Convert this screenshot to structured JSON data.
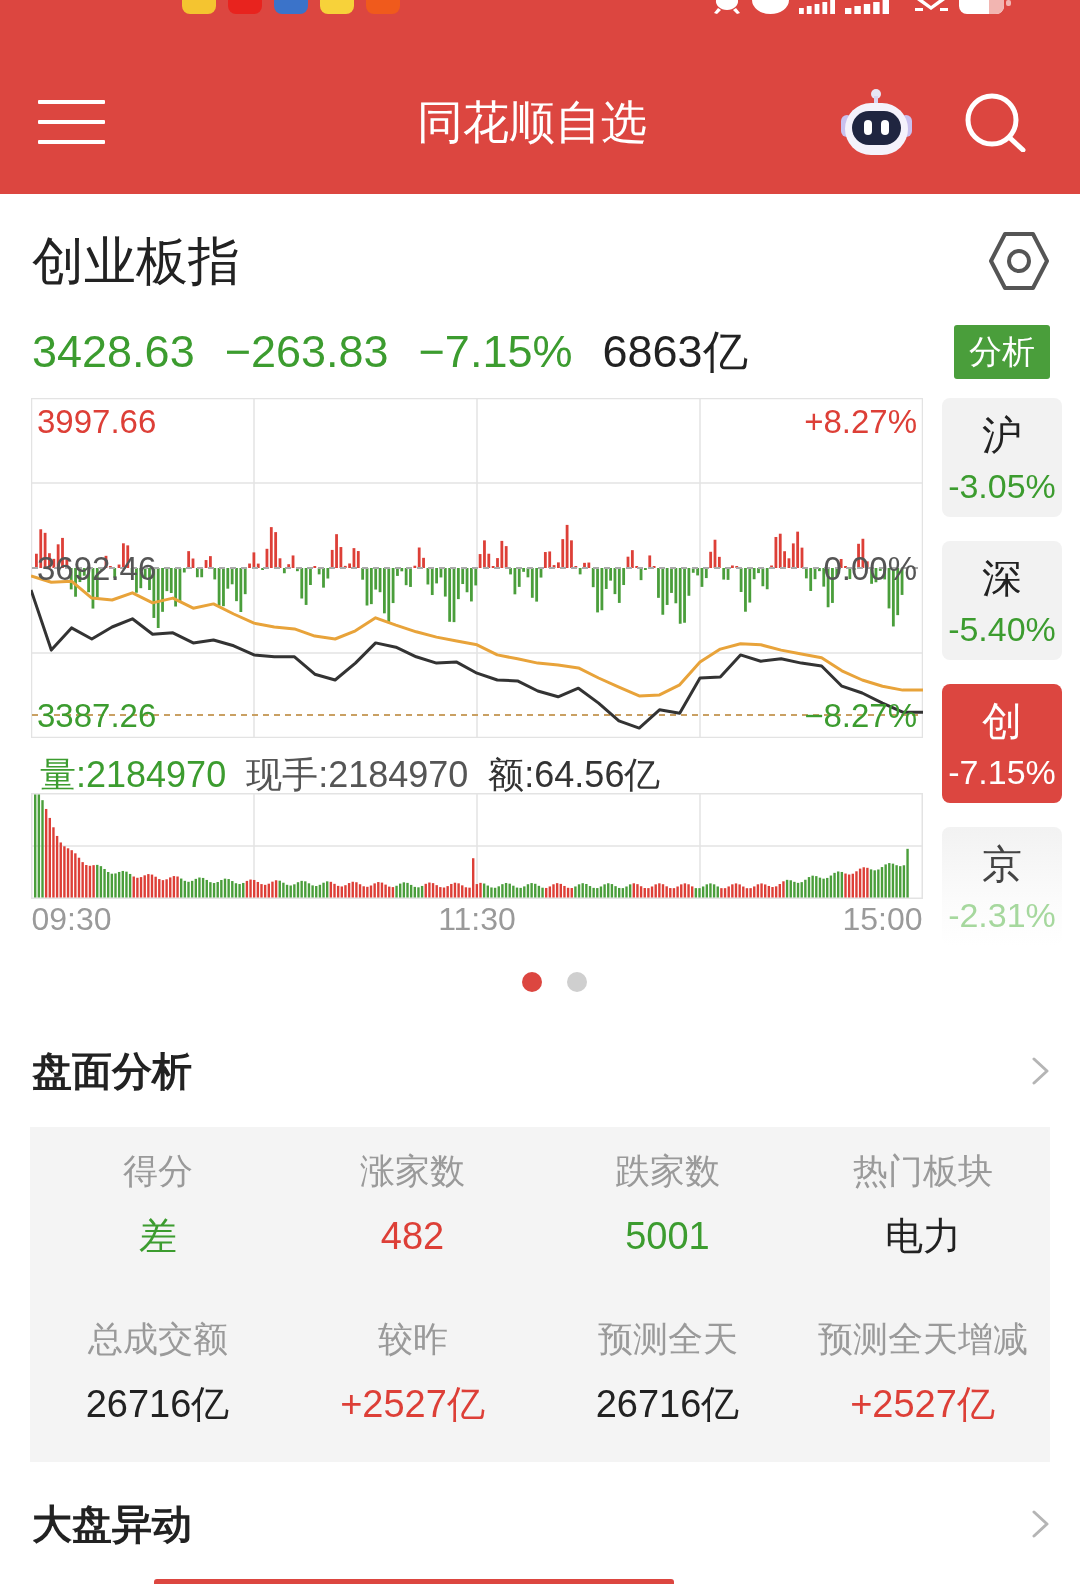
{
  "header": {
    "title": "同花顺自选"
  },
  "index": {
    "name": "创业板指",
    "price": "3428.63",
    "change": "−263.83",
    "change_pct": "−7.15%",
    "turnover": "6863亿",
    "color": "#3c9c2f",
    "analysis_button": "分析"
  },
  "chart": {
    "percent_labels": [
      "+8.27%",
      "0.00%",
      "−8.27%"
    ],
    "volume_stats": [
      {
        "text": "量:2184970",
        "color": "#3c9c2f"
      },
      {
        "text": "现手:2184970",
        "color": "#555555"
      },
      {
        "text": "额:64.56亿",
        "color": "#333333"
      }
    ],
    "chart_data": {
      "type": "line",
      "categories": [
        null,
        null,
        "09:30",
        null,
        null,
        null,
        null,
        null,
        null,
        null,
        null,
        null,
        null,
        null,
        null,
        null,
        null,
        null,
        null,
        null,
        null,
        null,
        "11:30",
        null,
        null,
        null,
        null,
        null,
        null,
        null,
        null,
        null,
        null,
        null,
        null,
        null,
        null,
        null,
        null,
        null,
        null,
        null,
        "15:00",
        null,
        null
      ],
      "series": [
        {
          "color": "#333333",
          "values": [
            3647,
            3522,
            3568,
            3545,
            3570,
            3587,
            3555,
            3558,
            3537,
            3543,
            3531,
            3512,
            3508,
            3508,
            3472,
            3460,
            3495,
            3537,
            3528,
            3508,
            3495,
            3497,
            3474,
            3460,
            3458,
            3437,
            3425,
            3443,
            3412,
            3375,
            3360,
            3398,
            3391,
            3464,
            3466,
            3512,
            3499,
            3504,
            3495,
            3489,
            3447,
            3433,
            3412,
            3393,
            3393
          ]
        },
        {
          "color": "#e8a33a",
          "values": [
            3676,
            3663,
            3665,
            3630,
            3626,
            3641,
            3620,
            3630,
            3609,
            3618,
            3597,
            3578,
            3570,
            3566,
            3551,
            3545,
            3562,
            3589,
            3574,
            3560,
            3549,
            3541,
            3533,
            3512,
            3504,
            3495,
            3491,
            3485,
            3464,
            3445,
            3427,
            3429,
            3450,
            3497,
            3524,
            3535,
            3533,
            3522,
            3514,
            3506,
            3479,
            3460,
            3447,
            3439,
            3439
          ]
        }
      ],
      "ylim": [
        3339.52,
        4045.4
      ],
      "yticks": [
        {
          "value": 3997.66,
          "label": "3997.66"
        },
        {
          "value": 3692.46,
          "label": "3692.46"
        },
        {
          "value": 3387.26,
          "label": "3387.26"
        }
      ],
      "grid": true,
      "ref_lines": [
        {
          "axis": "y",
          "value": 3692.46,
          "color": "#aaaaaa"
        },
        {
          "axis": "y",
          "value": 3387.26,
          "color": "#c9a063"
        }
      ]
    }
  },
  "markets": [
    {
      "label": "沪",
      "change": "-3.05%",
      "color": "#3c9c2f",
      "selected": false
    },
    {
      "label": "深",
      "change": "-5.40%",
      "color": "#3c9c2f",
      "selected": false
    },
    {
      "label": "创",
      "change": "-7.15%",
      "selected": true
    },
    {
      "label": "京",
      "change": "-2.31%",
      "color": "#a6d89e",
      "selected": false
    }
  ],
  "pager": [
    {
      "selected": true
    },
    {
      "selected": false
    }
  ],
  "analysis": {
    "title": "盘面分析",
    "cells": [
      {
        "label": "得分",
        "value": "差",
        "color": "#3c9c2f"
      },
      {
        "label": "涨家数",
        "value": "482",
        "color": "#dd3f37"
      },
      {
        "label": "跌家数",
        "value": "5001",
        "color": "#3c9c2f"
      },
      {
        "label": "热门板块",
        "value": "电力",
        "color": "#222222"
      },
      {
        "label": "总成交额",
        "value": "26716亿",
        "color": "#222222"
      },
      {
        "label": "较昨",
        "value": "+2527亿",
        "color": "#dd3f37"
      },
      {
        "label": "预测全天",
        "value": "26716亿",
        "color": "#222222"
      },
      {
        "label": "预测全天增减",
        "value": "+2527亿",
        "color": "#dd3f37"
      }
    ]
  },
  "movement": {
    "title": "大盘异动"
  }
}
